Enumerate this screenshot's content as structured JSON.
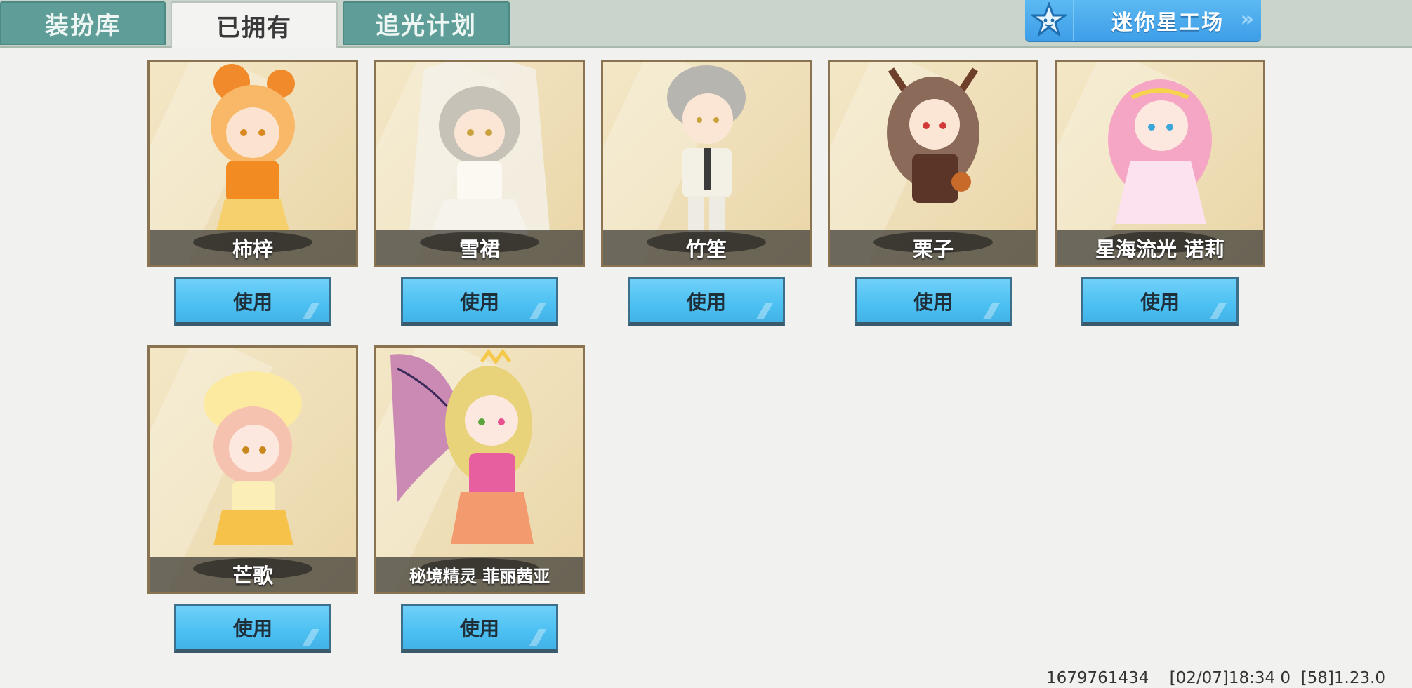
{
  "tabs": [
    {
      "label": "装扮库",
      "active": false
    },
    {
      "label": "已拥有",
      "active": true
    },
    {
      "label": "追光计划",
      "active": false
    }
  ],
  "workshop": {
    "label": "迷你星工场",
    "icon": "star-icon"
  },
  "use_label": "使用",
  "cards": [
    {
      "name": "柿梓",
      "theme": "#f08a2a"
    },
    {
      "name": "雪裙",
      "theme": "#e9e6df"
    },
    {
      "name": "竹笙",
      "theme": "#d8d6c8"
    },
    {
      "name": "栗子",
      "theme": "#7a4b38"
    },
    {
      "name": "星海流光 诺莉",
      "theme": "#f6a8c8"
    },
    {
      "name": "芒歌",
      "theme": "#f6c24a"
    },
    {
      "name": "秘境精灵 菲丽茜亚",
      "theme": "#e85fa0"
    }
  ],
  "status": {
    "id": "1679761434",
    "datetime": "[02/07]18:34 0",
    "version": "[58]1.23.0"
  }
}
